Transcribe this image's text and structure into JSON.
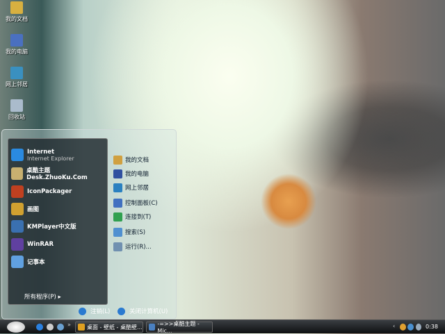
{
  "desktop": [
    {
      "label": "我的文档",
      "icon": "folder-icon"
    },
    {
      "label": "我的电脑",
      "icon": "computer-icon"
    },
    {
      "label": "网上邻居",
      "icon": "network-icon"
    },
    {
      "label": "回收站",
      "icon": "recycle-bin-icon"
    }
  ],
  "start_menu": {
    "pinned": [
      {
        "label": "Internet",
        "sub": "Internet Explorer",
        "color": "#2a8ae0"
      },
      {
        "label": "桌酷主题Desk.ZhuoKu.Com",
        "color": "#c8b070"
      },
      {
        "label": "IconPackager",
        "color": "#c04020"
      },
      {
        "label": "画图",
        "color": "#d0a030"
      },
      {
        "label": "KMPlayer中文版",
        "color": "#3a70b0"
      },
      {
        "label": "WinRAR",
        "color": "#6040a0"
      },
      {
        "label": "记事本",
        "color": "#60a0e0"
      }
    ],
    "all_programs": "所有程序(P)",
    "right": [
      {
        "label": "我的文档",
        "color": "#d0a040"
      },
      {
        "label": "我的电脑",
        "color": "#3050a0"
      },
      {
        "label": "网上邻居",
        "color": "#2a80c0"
      },
      {
        "label": "控制面板(C)",
        "color": "#4070c0"
      },
      {
        "label": "连接到(T)",
        "color": "#30a050"
      },
      {
        "label": "搜索(S)",
        "color": "#5090d0"
      },
      {
        "label": "运行(R)...",
        "color": "#7090b0"
      }
    ],
    "logoff": "注销(L)",
    "shutdown": "关闭计算机(U)"
  },
  "taskbar": {
    "tasks": [
      "桌面 - 壁纸 - 桌酷壁...",
      "-=>>桌酷主题 - Mic..."
    ],
    "clock": "0:38",
    "overflow": "»"
  }
}
